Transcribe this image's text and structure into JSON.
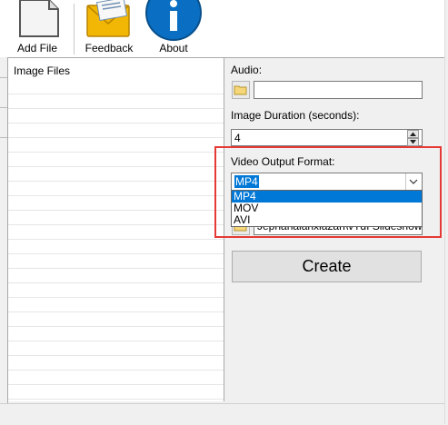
{
  "toolbar": {
    "buttons": [
      {
        "label": "Add File",
        "icon": "add-file-icon"
      },
      {
        "label": "Feedback",
        "icon": "feedback-envelope-icon"
      },
      {
        "label": "About",
        "icon": "about-info-icon"
      }
    ]
  },
  "file_list": {
    "header": "Image Files",
    "items": []
  },
  "settings": {
    "audio_label": "Audio:",
    "audio_value": "",
    "duration_label": "Image Duration (seconds):",
    "duration_value": "4",
    "format_label": "Video Output Format:",
    "format_selected": "MP4",
    "format_options": [
      "MP4",
      "MOV",
      "AVI"
    ],
    "output_path_partial": "Jepnanalanxiazan\\vTdI Slideshow Crea",
    "create_label": "Create"
  },
  "colors": {
    "selection": "#0078d7",
    "highlight_box": "#e53935",
    "info_icon": "#0a6fc2",
    "envelope": "#f2b705"
  }
}
